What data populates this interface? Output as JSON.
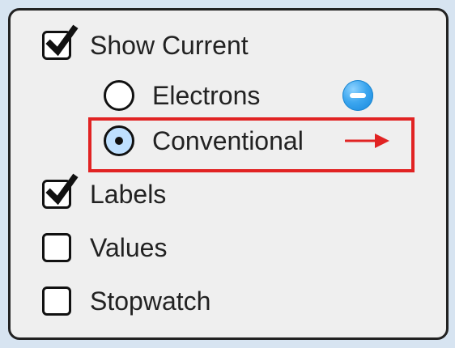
{
  "panel": {
    "show_current": {
      "label": "Show Current",
      "checked": true
    },
    "electrons": {
      "label": "Electrons",
      "selected": false,
      "icon": "electron-minus-icon"
    },
    "conventional": {
      "label": "Conventional",
      "selected": true,
      "icon": "red-arrow-right-icon"
    },
    "labels": {
      "label": "Labels",
      "checked": true
    },
    "values": {
      "label": "Values",
      "checked": false
    },
    "stopwatch": {
      "label": "Stopwatch",
      "checked": false
    }
  },
  "colors": {
    "background": "#d7e4f1",
    "panel": "#efefef",
    "highlight": "#e12323",
    "electron_blue": "#3ca6ef",
    "selected_radio": "#bfe0ff",
    "arrow_red": "#e12323"
  }
}
